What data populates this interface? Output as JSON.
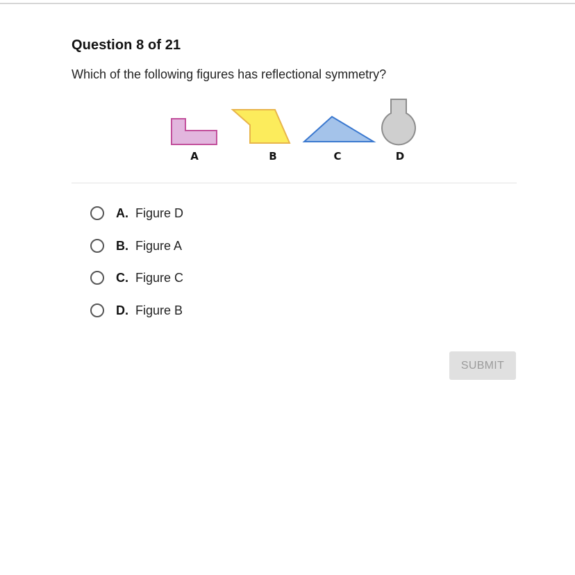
{
  "question": {
    "header": "Question 8 of 21",
    "text": "Which of the following figures has reflectional symmetry?"
  },
  "figure": {
    "labels": [
      "A",
      "B",
      "C",
      "D"
    ],
    "colors": {
      "A_fill": "#e2b6de",
      "A_stroke": "#c2509c",
      "B_fill": "#fcec5c",
      "B_stroke": "#e8b44a",
      "C_fill": "#a4c3ea",
      "C_stroke": "#3a78cf",
      "D_fill": "#cfcfcf",
      "D_stroke": "#8c8c8c"
    }
  },
  "options": [
    {
      "letter": "A.",
      "text": "Figure D"
    },
    {
      "letter": "B.",
      "text": "Figure A"
    },
    {
      "letter": "C.",
      "text": "Figure C"
    },
    {
      "letter": "D.",
      "text": "Figure B"
    }
  ],
  "submit": {
    "label": "SUBMIT",
    "enabled": false
  }
}
